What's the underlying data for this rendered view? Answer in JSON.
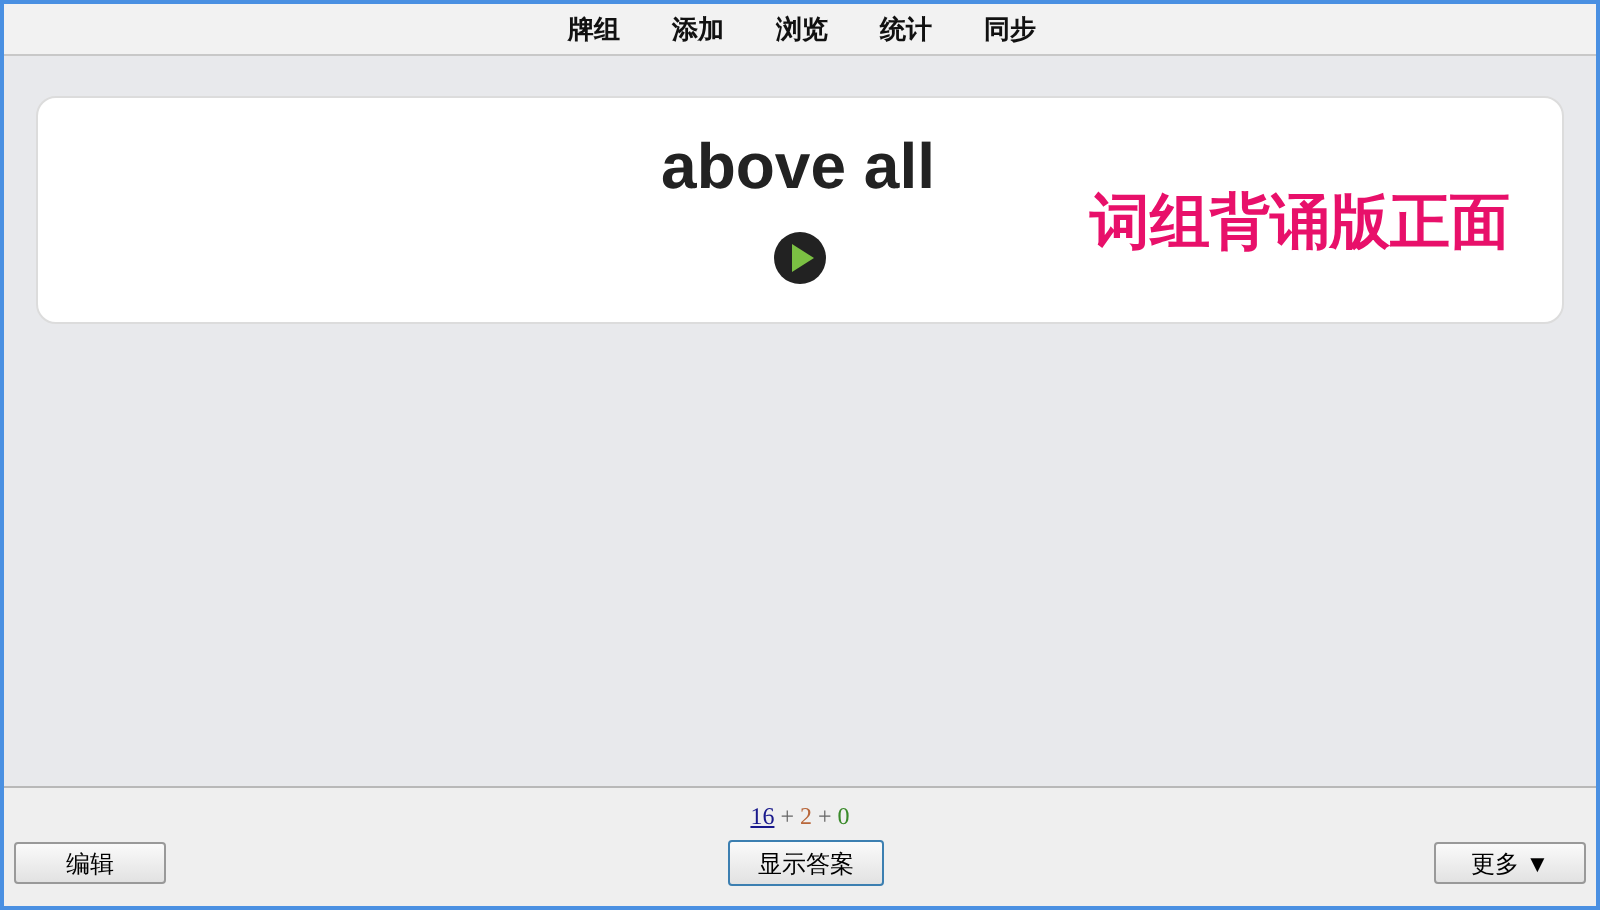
{
  "menu": [
    {
      "label": "牌组"
    },
    {
      "label": "添加"
    },
    {
      "label": "浏览"
    },
    {
      "label": "统计"
    },
    {
      "label": "同步"
    }
  ],
  "card": {
    "front": "above all",
    "annotation": "词组背诵版正面"
  },
  "counts": [
    {
      "value": "16",
      "color": "#1a1a8c",
      "selected": true
    },
    {
      "value": "2",
      "color": "#b8663a",
      "selected": false
    },
    {
      "value": "0",
      "color": "#3a8a2a",
      "selected": false
    }
  ],
  "count_separator": "+",
  "buttons": {
    "edit": "编辑",
    "show_answer": "显示答案",
    "more": "更多 ▼"
  }
}
